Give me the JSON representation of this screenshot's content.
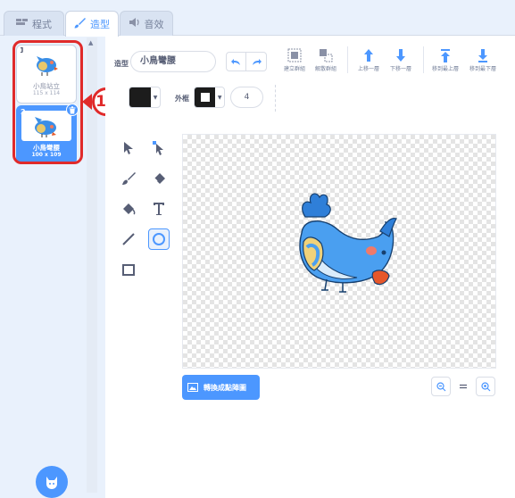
{
  "tabs": {
    "code": "程式",
    "costumes": "造型",
    "sounds": "音效"
  },
  "sidebar": {
    "costumes": [
      {
        "number": "1",
        "name": "小鳥站立",
        "size": "115 x 114",
        "selected": false
      },
      {
        "number": "2",
        "name": "小鳥彎腰",
        "size": "100 x 109",
        "selected": true
      }
    ],
    "delete_icon": "trash-icon",
    "choose_icon": "cat-icon"
  },
  "callout": {
    "label": "11"
  },
  "toolbar": {
    "name_label": "造型",
    "costume_name": "小鳥彎腰",
    "group_label": "建立群組",
    "ungroup_label": "解散群組",
    "forward_label": "上移一層",
    "backward_label": "下移一層",
    "front_label": "移到最上層",
    "back_label": "移到最下層"
  },
  "properties": {
    "fill_color": "#1c1c1c",
    "outline_label": "外框",
    "outline_color": "#1c1c1c",
    "outline_width": "4"
  },
  "canvas": {
    "convert_button_label": "轉換成點陣圖"
  },
  "colors": {
    "accent": "#4c97ff",
    "callout": "#e02a2a"
  }
}
